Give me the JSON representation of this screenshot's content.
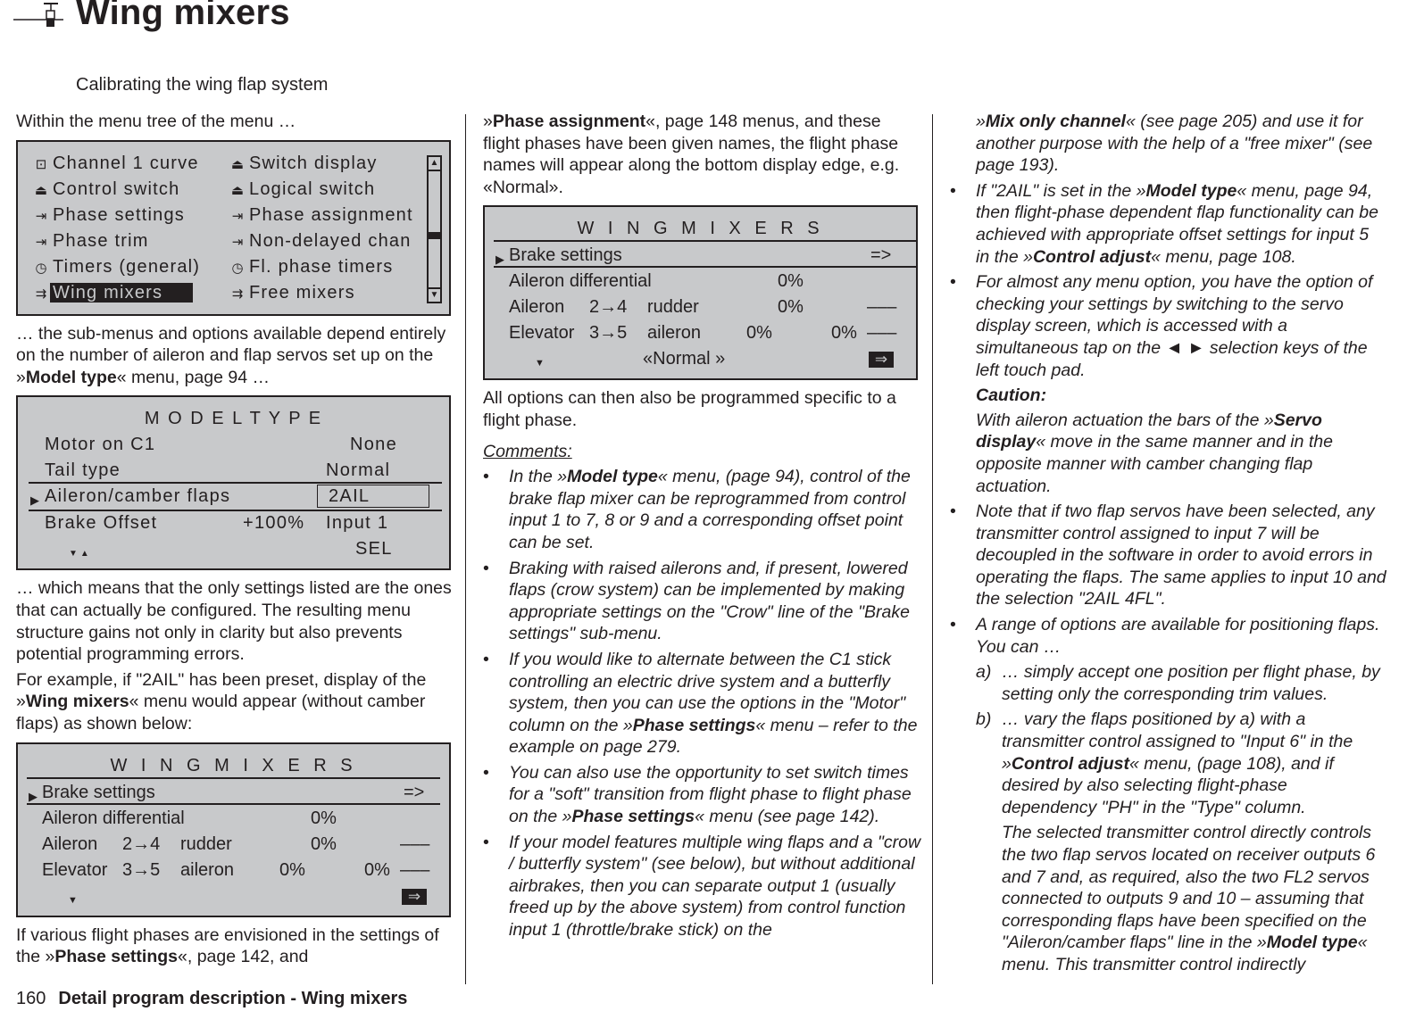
{
  "header": {
    "title": "Wing mixers",
    "subtitle": "Calibrating the wing flap system",
    "icon": "wing-mixer-icon"
  },
  "col1": {
    "intro": "Within the menu tree of the menu …",
    "menu_screen": {
      "items_left": [
        {
          "icon": "curve-icon",
          "glyph": "⊡",
          "label": "Channel 1 curve"
        },
        {
          "icon": "switch-icon",
          "glyph": "⏏",
          "label": "Control switch"
        },
        {
          "icon": "phase-icon",
          "glyph": "⇥",
          "label": "Phase settings"
        },
        {
          "icon": "phase-icon",
          "glyph": "⇥",
          "label": "Phase trim"
        },
        {
          "icon": "timer-icon",
          "glyph": "◷",
          "label": "Timers (general)"
        },
        {
          "icon": "mixer-icon",
          "glyph": "⇉",
          "label": "Wing mixers",
          "selected": true
        }
      ],
      "items_right": [
        {
          "icon": "switch-icon",
          "glyph": "⏏",
          "label": "Switch display"
        },
        {
          "icon": "switch-icon",
          "glyph": "⏏",
          "label": "Logical switch"
        },
        {
          "icon": "phase-icon",
          "glyph": "⇥",
          "label": "Phase assignment"
        },
        {
          "icon": "phase-icon",
          "glyph": "⇥",
          "label": "Non-delayed chan"
        },
        {
          "icon": "timer-icon",
          "glyph": "◷",
          "label": "Fl. phase timers"
        },
        {
          "icon": "mixer-icon",
          "glyph": "⇉",
          "label": "Free mixers"
        }
      ],
      "scroll_up": "▲",
      "scroll_down": "▼"
    },
    "p2_a": "… the sub-menus and options available depend entirely on the number of aileron and flap servos set up on the »",
    "p2_b": "Model type",
    "p2_c": "« menu, page 94 …",
    "model_screen": {
      "title": "M O D E L T Y P E",
      "rows": [
        {
          "label": "Motor  on  C1",
          "value": "None"
        },
        {
          "label": "Tail type",
          "value": "Normal"
        },
        {
          "label": "Aileron/camber flaps",
          "value": "2AIL",
          "selected": true
        },
        {
          "label": "Brake Offset",
          "mid": "+100%",
          "value": "Input 1"
        }
      ],
      "nav": "▼▲",
      "sel": "SEL"
    },
    "p3": "… which means that the only settings listed are the ones that can actually be configured. The resulting menu structure gains not only in clarity but also prevents potential programming errors.",
    "p4_a": "For example, if \"2AIL\" has been preset, display of the »",
    "p4_b": "Wing mixers",
    "p4_c": "« menu would appear (without camber flaps) as shown below:",
    "wing_screen": {
      "title": "W I N G   M I X E R S",
      "brake": "Brake settings",
      "brake_arrow": "=>",
      "diff_label": "Aileron differential",
      "diff_value": "0%",
      "ail_label": "Aileron",
      "ail_route": "2→4",
      "ail_target": "rudder",
      "ail_value": "0%",
      "ail_sw": "–––",
      "elev_label": "Elevator",
      "elev_route": "3→5",
      "elev_target": "aileron",
      "elev_value1": "0%",
      "elev_value2": "0%",
      "elev_sw": "–––",
      "nav": "▼",
      "enter": "⇒"
    },
    "p5_a": "If various flight phases are envisioned in the settings of the »",
    "p5_b": "Phase settings",
    "p5_c": "«, page 142, and"
  },
  "col2": {
    "p1_a": "»",
    "p1_b": "Phase assignment",
    "p1_c": "«, page 148 menus, and these flight phases have been given names, the flight phase names will appear along the bottom display edge,  e.g. «Normal».",
    "wing_screen": {
      "title": "W I N G   M I X E R S",
      "brake": "Brake settings",
      "brake_arrow": "=>",
      "diff_label": "Aileron differential",
      "diff_value": "0%",
      "ail_label": "Aileron",
      "ail_route": "2→4",
      "ail_target": "rudder",
      "ail_value": "0%",
      "ail_sw": "–––",
      "elev_label": "Elevator",
      "elev_route": "3→5",
      "elev_target": "aileron",
      "elev_value1": "0%",
      "elev_value2": "0%",
      "elev_sw": "–––",
      "nav": "▼",
      "phase": "«Normal »",
      "enter": "⇒"
    },
    "p2": "All options can then also be programmed specific to a flight phase.",
    "comments_heading": "Comments:",
    "bullets": [
      {
        "a": "In the »",
        "b": "Model type",
        "c": "« menu, (page 94), control of the brake flap mixer can be reprogrammed from control input 1 to 7, 8 or 9 and a corresponding offset point can be set."
      },
      {
        "a": "Braking with raised ailerons and, if present, lowered flaps (crow system) can be implemented by making appropriate settings on the \"Crow\" line of the \"Brake settings\" sub-menu.",
        "b": "",
        "c": ""
      },
      {
        "a": "If you would like to alternate between the C1 stick controlling an electric drive system and a butterfly system, then you can use the options in the \"Motor\" column on the »",
        "b": "Phase settings",
        "c": "« menu – refer to the example on page 279."
      },
      {
        "a": "You can also use the opportunity to set switch times for a \"soft\" transition from flight phase to flight phase on the »",
        "b": "Phase settings",
        "c": "« menu (see page 142)."
      },
      {
        "a": "If your model features multiple wing flaps and a \"crow / butterfly system\" (see below), but without additional airbrakes, then you can separate output 1 (usually freed up by the above system) from control function input 1 (throttle/brake stick) on the",
        "b": "",
        "c": ""
      }
    ]
  },
  "col3": {
    "cont_a": "»",
    "cont_b": "Mix only channel",
    "cont_c": "« (see page 205) and use it for another purpose with the help of a \"free mixer\" (see page 193).",
    "bullets": [
      {
        "a": "If \"2AIL\" is set in the »",
        "b": "Model type",
        "c": "« menu, page 94, then flight-phase dependent flap functionality can be achieved with appropriate offset settings for input 5 in the »",
        "d": "Control adjust",
        "e": "« menu, page 108."
      },
      {
        "a": "For almost any menu option, you have the option of checking your settings by switching to the servo display screen, which is accessed with a simultaneous tap on the ◄ ► selection keys of the left touch pad.",
        "b": "",
        "c": "",
        "d": "",
        "e": ""
      }
    ],
    "caution_heading": "Caution:",
    "caution_a": "With aileron actuation the bars of the »",
    "caution_b": "Servo display",
    "caution_c": "« move in the same manner and in the opposite manner with camber changing flap actuation.",
    "bullet3": "Note that if two flap servos have been selected, any transmitter control assigned to input 7 will be decoupled in the software in order to avoid errors in operating the flaps. The same applies to input 10 and the selection \"2AIL 4FL\".",
    "bullet4": "A range of options are available for positioning flaps. You can …",
    "sub_a_label": "a)",
    "sub_a": "… simply accept one position per flight phase, by setting only the corresponding trim values.",
    "sub_b_label": "b)",
    "sub_b_1": "… vary the flaps positioned by a) with a transmitter control assigned to \"Input 6\" in the »",
    "sub_b_2": "Control adjust",
    "sub_b_3": "« menu, (page 108), and if desired by also selecting flight-phase dependency \"PH\" in the \"Type\" column.",
    "sub_b_p2_a": "The selected transmitter control directly controls the two flap servos located on receiver outputs 6 and 7 and, as required, also the two FL2 servos connected to outputs 9 and 10 – assuming that corresponding flaps have been specified on the \"Aileron/camber flaps\" line in the »",
    "sub_b_p2_b": "Model type",
    "sub_b_p2_c": "« menu. This transmitter control indirectly"
  },
  "footer": {
    "page_number": "160",
    "section": "Detail program description - Wing mixers"
  }
}
